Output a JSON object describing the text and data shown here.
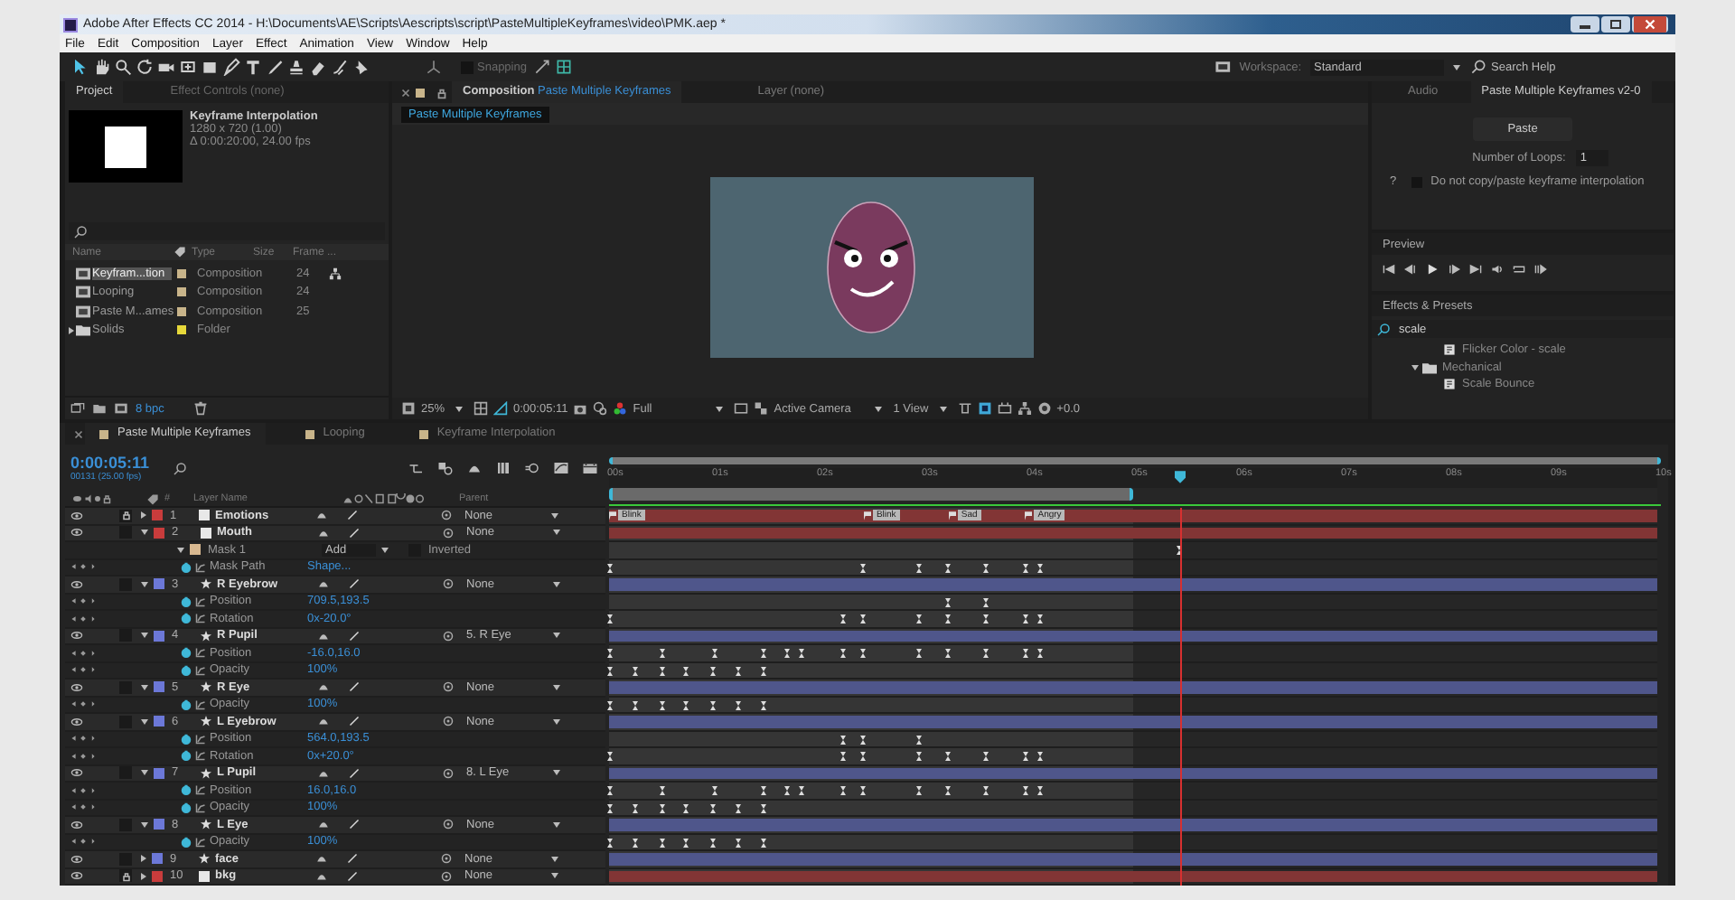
{
  "window": {
    "title": "Adobe After Effects CC 2014 - H:\\Documents\\AE\\Scripts\\Aescripts\\script\\PasteMultipleKeyframes\\video\\PMK.aep *"
  },
  "menu": [
    "File",
    "Edit",
    "Composition",
    "Layer",
    "Effect",
    "Animation",
    "View",
    "Window",
    "Help"
  ],
  "toolbar": {
    "snapping": {
      "label": "Snapping",
      "checked": false
    },
    "workspace_label": "Workspace:",
    "workspace": "Standard",
    "search": "Search Help"
  },
  "project": {
    "tabs": [
      {
        "label": "Project",
        "selected": true
      },
      {
        "label": "Effect Controls (none)",
        "selected": false
      }
    ],
    "comp_name": "Keyframe Interpolation",
    "info": [
      "1280 x 720 (1.00)",
      "Δ 0:00:20:00, 24.00 fps"
    ],
    "columns": [
      "Name",
      "Type",
      "Size",
      "Frame ..."
    ],
    "items": [
      {
        "name": "Keyfram...tion",
        "kind": "composition",
        "type": "Composition",
        "frame_rate": "24",
        "color": "#c8b48a",
        "selected": true
      },
      {
        "name": "Looping",
        "kind": "composition",
        "type": "Composition",
        "frame_rate": "24",
        "color": "#c8b48a",
        "selected": false
      },
      {
        "name": "Paste M...ames",
        "kind": "composition",
        "type": "Composition",
        "frame_rate": "25",
        "color": "#c8b48a",
        "selected": false
      },
      {
        "name": "Solids",
        "kind": "folder",
        "type": "Folder",
        "color": "#e6d83a",
        "selected": false
      }
    ],
    "bpc": "8 bpc"
  },
  "composition": {
    "tabs": [
      {
        "label": "Composition",
        "name": "Paste Multiple Keyframes",
        "selected": true
      },
      {
        "label": "Layer (none)",
        "selected": false
      }
    ],
    "breadcrumb": "Paste Multiple Keyframes",
    "zoom": "25%",
    "time": "0:00:05:11",
    "resolution": "Full",
    "camera": "Active Camera",
    "views": "1 View",
    "exposure": "+0.0"
  },
  "script_panel": {
    "tabs": [
      {
        "label": "Audio",
        "selected": false
      },
      {
        "label": "Paste Multiple Keyframes v2-0",
        "selected": true
      }
    ],
    "button": "Paste",
    "loops_label": "Number of Loops:",
    "loops": "1",
    "help": "?",
    "checkbox": {
      "label": "Do not copy/paste keyframe interpolation",
      "checked": false
    }
  },
  "preview": {
    "title": "Preview"
  },
  "effects": {
    "title": "Effects & Presets",
    "search": "scale",
    "items": [
      {
        "name": "Flicker Color - scale",
        "kind": "preset"
      },
      {
        "name": "Mechanical",
        "kind": "folder",
        "expanded": true,
        "children": [
          {
            "name": "Scale Bounce",
            "kind": "preset"
          }
        ]
      }
    ]
  },
  "timeline": {
    "tabs": [
      {
        "label": "Paste Multiple Keyframes",
        "selected": true
      },
      {
        "label": "Looping",
        "selected": false
      },
      {
        "label": "Keyframe Interpolation",
        "selected": false
      }
    ],
    "time": "0:00:05:11",
    "frames": "00131 (25.00 fps)",
    "columns": {
      "number": "#",
      "name": "Layer Name",
      "parent": "Parent"
    },
    "ruler": [
      "00s",
      "01s",
      "02s",
      "03s",
      "04s",
      "05s",
      "06s",
      "07s",
      "08s",
      "09s",
      "10s"
    ],
    "work_area": {
      "level": 0.5
    },
    "playhead": {
      "level": 0.544
    },
    "markers": [
      "Blink",
      "Blink",
      "Sad",
      "Angry"
    ],
    "rows": [
      {
        "kind": "solid",
        "number": "1",
        "name": "Emotions",
        "color": "#c83c3c",
        "expanded": false,
        "locked": true,
        "parent": "None"
      },
      {
        "kind": "solid",
        "number": "2",
        "name": "Mouth",
        "color": "#c83c3c",
        "expanded": true,
        "locked": false,
        "parent": "None"
      },
      {
        "kind": "mask",
        "name": "Mask 1",
        "color": "#d8b890",
        "mode": "Add",
        "inverted": {
          "label": "Inverted",
          "checked": false
        }
      },
      {
        "kind": "property",
        "name": "Mask Path",
        "value": "Shape..."
      },
      {
        "kind": "shape",
        "number": "3",
        "name": "R Eyebrow",
        "color": "#6c78d8",
        "expanded": true,
        "locked": false,
        "parent": "None"
      },
      {
        "kind": "property",
        "name": "Position",
        "value": "709.5,193.5"
      },
      {
        "kind": "property",
        "name": "Rotation",
        "value": "0x-20.0°"
      },
      {
        "kind": "shape",
        "number": "4",
        "name": "R Pupil",
        "color": "#6c78d8",
        "expanded": true,
        "locked": false,
        "parent": "5. R Eye"
      },
      {
        "kind": "property",
        "name": "Position",
        "value": "-16.0,16.0"
      },
      {
        "kind": "property",
        "name": "Opacity",
        "value": "100%"
      },
      {
        "kind": "shape",
        "number": "5",
        "name": "R Eye",
        "color": "#6c78d8",
        "expanded": true,
        "locked": false,
        "parent": "None"
      },
      {
        "kind": "property",
        "name": "Opacity",
        "value": "100%"
      },
      {
        "kind": "shape",
        "number": "6",
        "name": "L Eyebrow",
        "color": "#6c78d8",
        "expanded": true,
        "locked": false,
        "parent": "None"
      },
      {
        "kind": "property",
        "name": "Position",
        "value": "564.0,193.5"
      },
      {
        "kind": "property",
        "name": "Rotation",
        "value": "0x+20.0°"
      },
      {
        "kind": "shape",
        "number": "7",
        "name": "L Pupil",
        "color": "#6c78d8",
        "expanded": true,
        "locked": false,
        "parent": "8. L Eye"
      },
      {
        "kind": "property",
        "name": "Position",
        "value": "16.0,16.0"
      },
      {
        "kind": "property",
        "name": "Opacity",
        "value": "100%"
      },
      {
        "kind": "shape",
        "number": "8",
        "name": "L Eye",
        "color": "#6c78d8",
        "expanded": true,
        "locked": false,
        "parent": "None"
      },
      {
        "kind": "property",
        "name": "Opacity",
        "value": "100%"
      },
      {
        "kind": "shape",
        "number": "9",
        "name": "face",
        "color": "#6c78d8",
        "expanded": false,
        "locked": false,
        "parent": "None"
      },
      {
        "kind": "solid",
        "number": "10",
        "name": "bkg",
        "color": "#c83c3c",
        "expanded": false,
        "locked": true,
        "parent": "None"
      }
    ]
  }
}
